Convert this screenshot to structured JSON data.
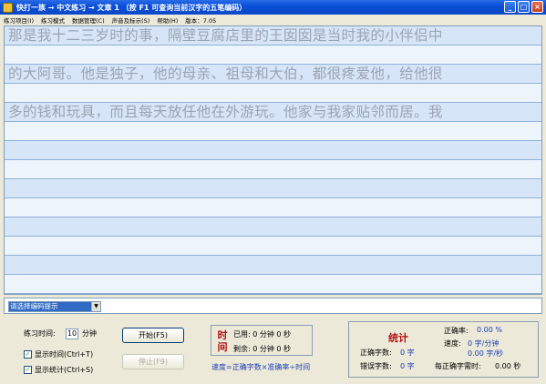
{
  "window": {
    "title": "快打一族 → 中文练习 → 文章 1      （按 F1 可查询当前汉字的五笔编码）",
    "minimize": "_",
    "maximize": "□",
    "close": "×"
  },
  "menu": {
    "items": [
      "练习项目(I)",
      "练习模式",
      "数据管理(C)",
      "声音及标示(S)",
      "帮助(H)",
      "版本：7.05"
    ]
  },
  "practice": {
    "lines": [
      "那是我十二三岁时的事，隔壁豆腐店里的王囡囡是当时我的小伴侣中",
      "的大阿哥。他是独子，他的母亲、祖母和大伯，都很疼爱他，给他很",
      "多的钱和玩具，而且每天放任他在外游玩。他家与我家贴邻而居。我"
    ]
  },
  "encoding": {
    "selected": "请选择编码提示",
    "arrow": "▼"
  },
  "controls": {
    "time_label": "练习时间:",
    "time_value": "10",
    "time_unit": "分钟",
    "show_time": {
      "label": "显示时间(Ctrl+T)",
      "checked": "✓"
    },
    "show_stats": {
      "label": "显示统计(Ctrl+S)",
      "checked": "✓"
    },
    "start_button": "开始(F5)",
    "stop_button": "停止(F9)"
  },
  "timer": {
    "title_top": "时",
    "title_bottom": "间",
    "used": "已用: 0 分钟 0 秒",
    "remaining": "剩余: 0 分钟 0 秒",
    "formula": "速度=正确字数×准确率÷时间"
  },
  "stats": {
    "title": "统计",
    "correct_label": "正确字数:",
    "correct_value": "0 字",
    "wrong_label": "错误字数:",
    "wrong_value": "0 字",
    "accuracy_label": "正确率:",
    "accuracy_value": "0.00 %",
    "speed_label": "速度:",
    "speed_per_min": "0 字/分钟",
    "speed_per_sec": "0.00 字/秒",
    "time_per_char_label": "每正确字需时:",
    "time_per_char_value": "0.00 秒"
  }
}
